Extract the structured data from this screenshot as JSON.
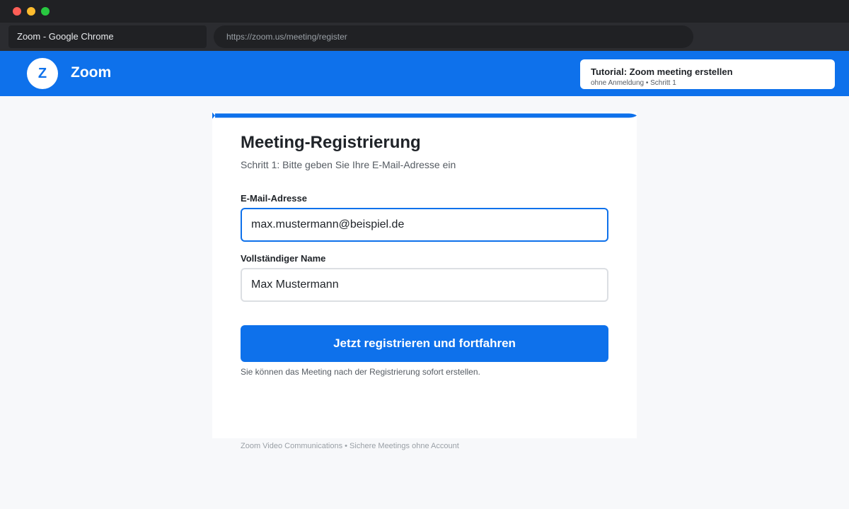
{
  "browser": {
    "tab_title": "Zoom - Google Chrome",
    "url": "https://zoom.us/meeting/register"
  },
  "header": {
    "logo_letter": "Z",
    "brand": "Zoom",
    "tutorial_title": "Tutorial: Zoom meeting erstellen",
    "tutorial_subtitle": "ohne Anmeldung • Schritt 1"
  },
  "form": {
    "title": "Meeting-Registrierung",
    "subtitle": "Schritt 1: Bitte geben Sie Ihre E-Mail-Adresse ein",
    "email_label": "E-Mail-Adresse",
    "email_value": "max.mustermann@beispiel.de",
    "name_label": "Vollständiger Name",
    "name_value": "Max Mustermann",
    "submit_label": "Jetzt registrieren und fortfahren",
    "hint": "Sie können das Meeting nach der Registrierung sofort erstellen."
  },
  "footer": "Zoom Video Communications • Sichere Meetings ohne Account",
  "colors": {
    "brand_blue": "#0e71eb",
    "chrome_dark": "#202124",
    "page_bg": "#f7f8fa"
  }
}
